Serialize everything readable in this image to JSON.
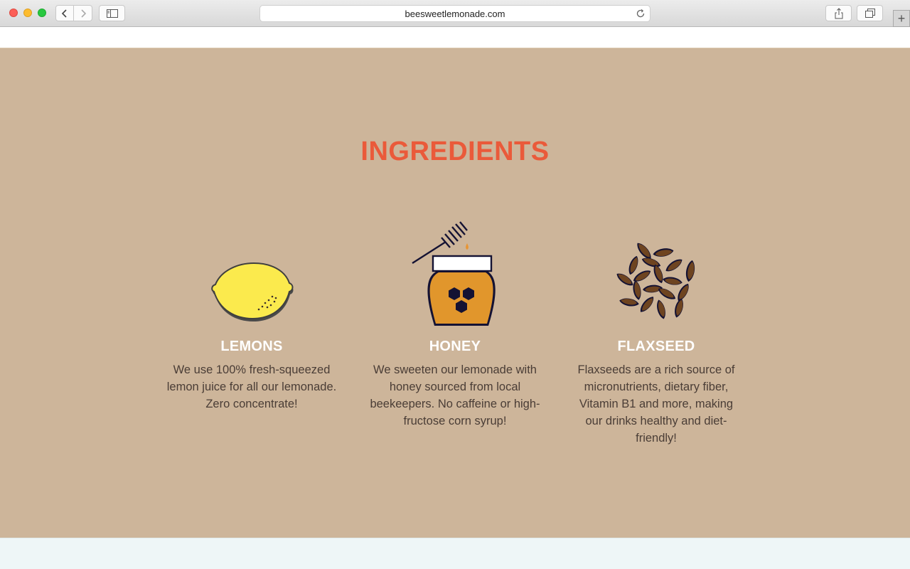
{
  "browser": {
    "url": "beesweetlemonade.com",
    "icons": {
      "back": "chevron-left-icon",
      "forward": "chevron-right-icon",
      "sidebar": "sidebar-icon",
      "reload": "reload-icon",
      "share": "share-icon",
      "tabs": "tabs-overview-icon",
      "new_tab": "plus-icon"
    },
    "new_tab_label": "+"
  },
  "ingredients": {
    "title": "INGREDIENTS",
    "title_color": "#ea5a3a",
    "background_color": "#cdb59a",
    "items": [
      {
        "name": "LEMONS",
        "icon": "lemon-icon",
        "description": "We use 100% fresh-squeezed lemon juice for all our lemonade. Zero concentrate!"
      },
      {
        "name": "HONEY",
        "icon": "honey-jar-icon",
        "description": "We sweeten our lemonade with honey sourced from local beekeepers. No caffeine or high-fructose corn syrup!"
      },
      {
        "name": "FLAXSEED",
        "icon": "flaxseed-icon",
        "description": "Flaxseeds are a rich source of micronutrients, dietary fiber, Vitamin B1 and more, making our drinks healthy and diet-friendly!"
      }
    ]
  }
}
